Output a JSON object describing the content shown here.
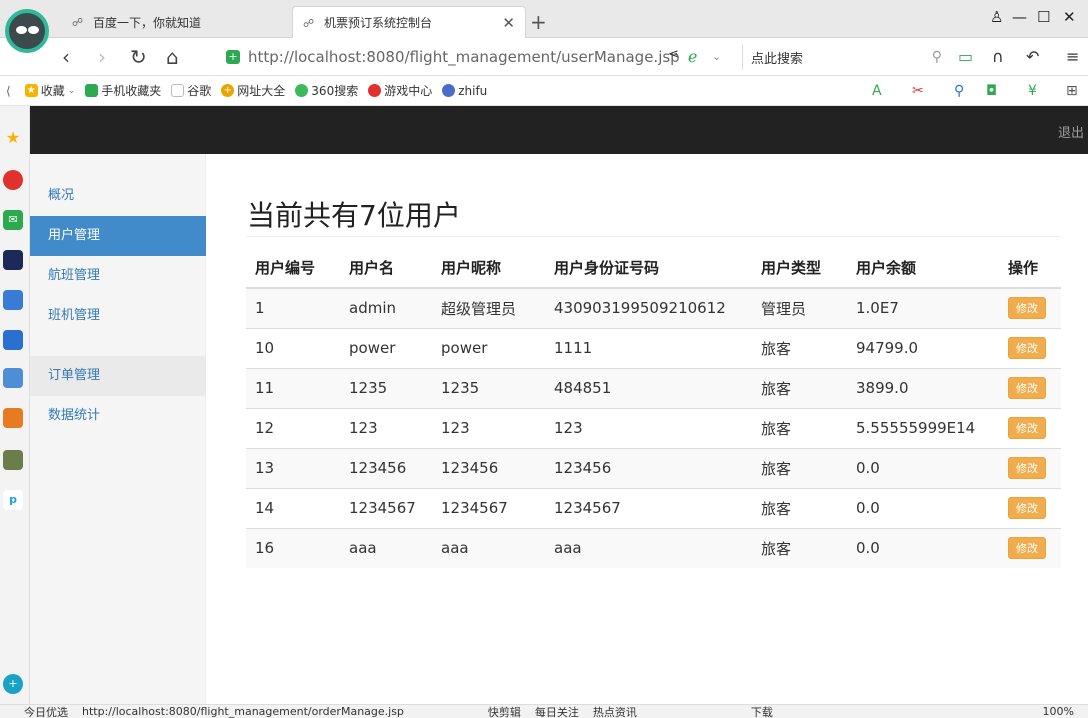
{
  "browser": {
    "tabs": [
      {
        "title": "百度一下，你就知道"
      },
      {
        "title": "机票预订系统控制台"
      }
    ],
    "url": "http://localhost:8080/flight_management/userManage.jsp",
    "search_label": "点此搜索",
    "bookmarks": [
      "收藏",
      "手机收藏夹",
      "谷歌",
      "网址大全",
      "360搜索",
      "游戏中心",
      "zhifu"
    ],
    "status": {
      "left_label": "今日优选",
      "hover_url": "http://localhost:8080/flight_management/orderManage.jsp",
      "items": [
        "快剪辑",
        "每日关注",
        "热点资讯",
        "下载"
      ],
      "zoom": "100%"
    }
  },
  "app": {
    "logout": "退出",
    "sidebar": [
      {
        "label": "概况"
      },
      {
        "label": "用户管理"
      },
      {
        "label": "航班管理"
      },
      {
        "label": "班机管理"
      },
      {
        "label": "订单管理"
      },
      {
        "label": "数据统计"
      }
    ],
    "title": "当前共有7位用户",
    "columns": [
      "用户编号",
      "用户名",
      "用户昵称",
      "用户身份证号码",
      "用户类型",
      "用户余额",
      "操作"
    ],
    "edit_label": "修改",
    "rows": [
      [
        "1",
        "admin",
        "超级管理员",
        "430903199509210612",
        "管理员",
        "1.0E7"
      ],
      [
        "10",
        "power",
        "power",
        "1111",
        "旅客",
        "94799.0"
      ],
      [
        "11",
        "1235",
        "1235",
        "484851",
        "旅客",
        "3899.0"
      ],
      [
        "12",
        "123",
        "123",
        "123",
        "旅客",
        "5.55555999E14"
      ],
      [
        "13",
        "123456",
        "123456",
        "123456",
        "旅客",
        "0.0"
      ],
      [
        "14",
        "1234567",
        "1234567",
        "1234567",
        "旅客",
        "0.0"
      ],
      [
        "16",
        "aaa",
        "aaa",
        "aaa",
        "旅客",
        "0.0"
      ]
    ]
  },
  "colors": {
    "topnav": "#222222",
    "active": "#428bca",
    "edit_button": "#f0ad4e",
    "link": "#337ab7"
  }
}
